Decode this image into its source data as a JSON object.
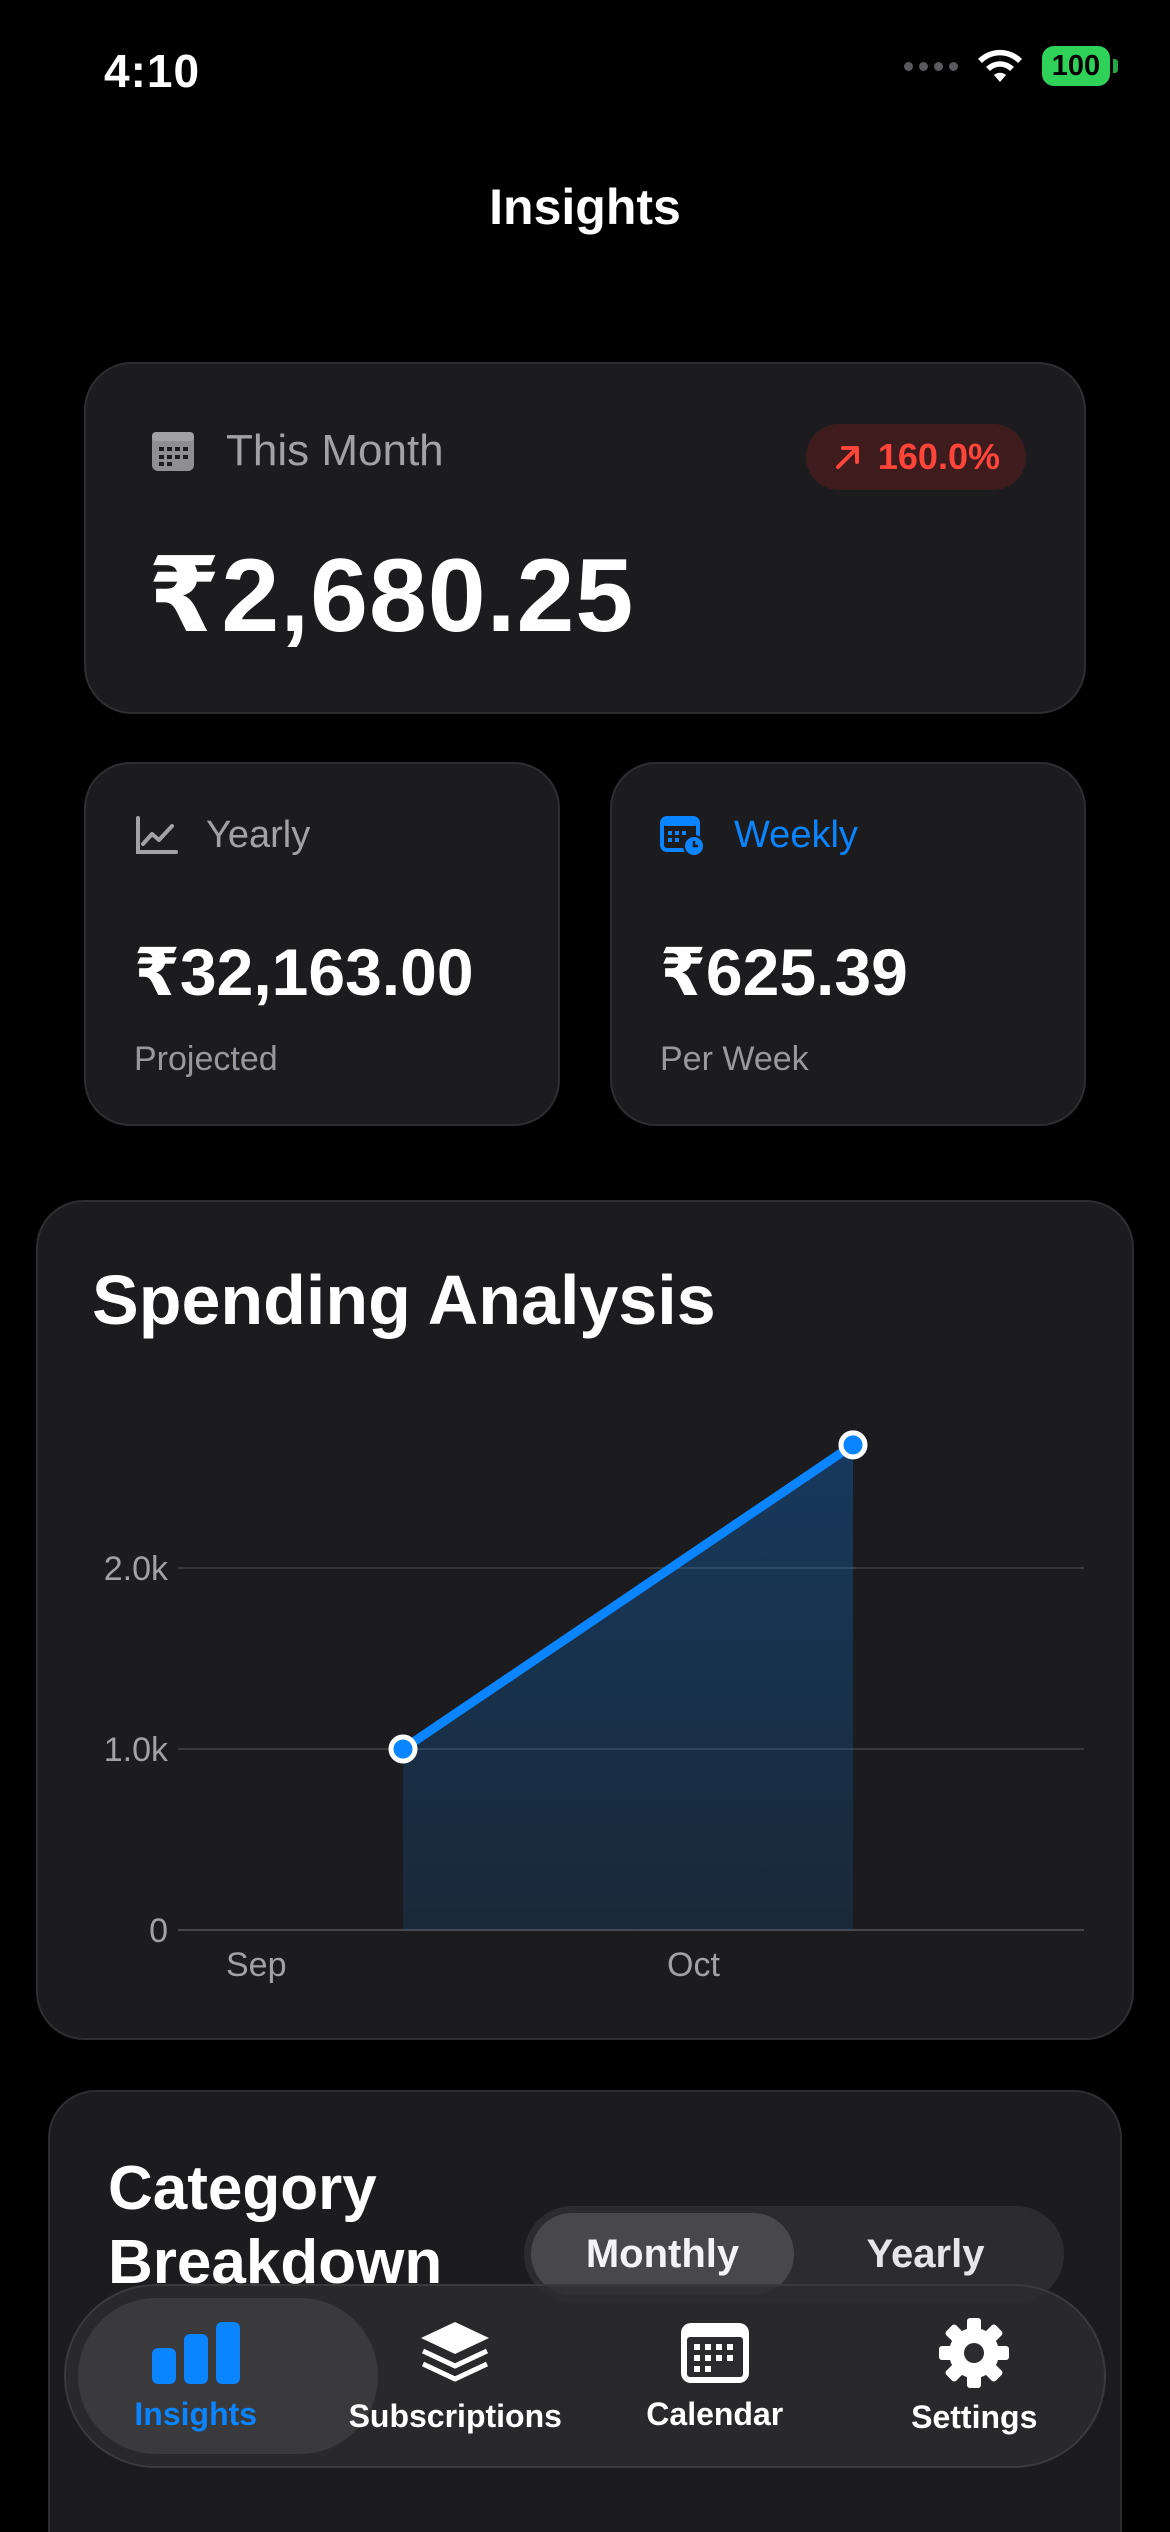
{
  "status_bar": {
    "time": "4:10",
    "battery": "100"
  },
  "header": {
    "title": "Insights"
  },
  "this_month": {
    "label": "This Month",
    "amount": "₹2,680.25",
    "change": "160.0%"
  },
  "yearly": {
    "label": "Yearly",
    "amount": "₹32,163.00",
    "caption": "Projected"
  },
  "weekly": {
    "label": "Weekly",
    "amount": "₹625.39",
    "caption": "Per Week"
  },
  "spending_analysis": {
    "title": "Spending Analysis"
  },
  "chart_data": {
    "type": "area",
    "title": "Spending Analysis",
    "x": [
      "Sep",
      "Oct"
    ],
    "series": [
      {
        "values": [
          1000,
          2680.25
        ]
      }
    ],
    "y_ticks": [
      "0",
      "1.0k",
      "2.0k"
    ],
    "x_ticks": [
      "Sep",
      "Oct"
    ],
    "ylim": [
      0,
      2700
    ],
    "grid": true,
    "color": "#0a84ff"
  },
  "category_breakdown": {
    "title": "Category Breakdown",
    "segments": [
      "Monthly",
      "Yearly"
    ],
    "selected": "Monthly"
  },
  "tab_bar": {
    "items": [
      {
        "label": "Insights",
        "icon": "chart-bar-icon"
      },
      {
        "label": "Subscriptions",
        "icon": "layers-icon"
      },
      {
        "label": "Calendar",
        "icon": "calendar-icon"
      },
      {
        "label": "Settings",
        "icon": "gear-icon"
      }
    ],
    "active": "Insights"
  },
  "colors": {
    "accent": "#0a84ff",
    "negative": "#ff453a",
    "card": "#1c1c1e",
    "battery": "#30d158"
  }
}
